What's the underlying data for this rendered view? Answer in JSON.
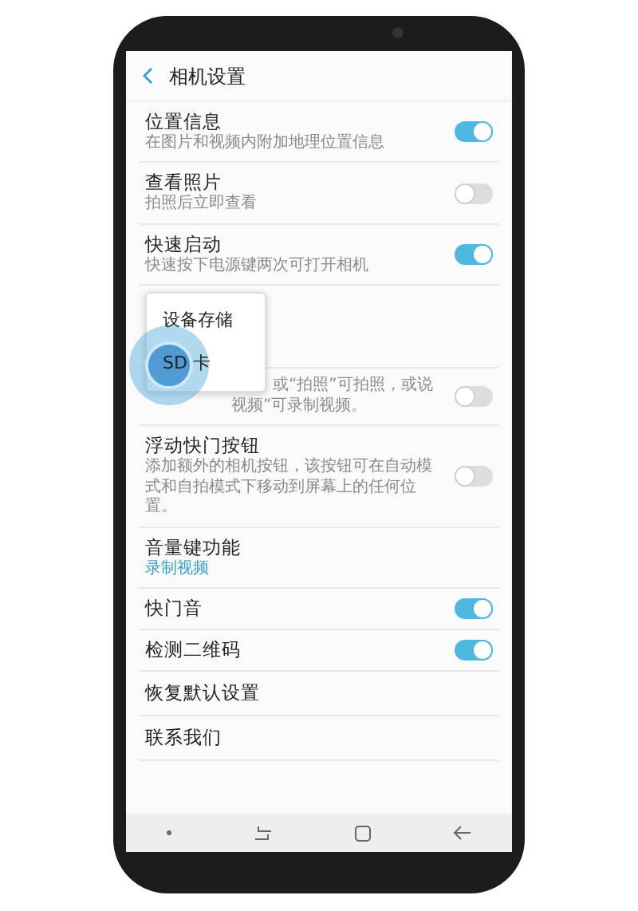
{
  "screen_title": "相机设置",
  "settings": [
    {
      "kind": "toggle",
      "title": "位置信息",
      "subtitle": "在图片和视频内附加地理位置信息",
      "on": true
    },
    {
      "kind": "toggle",
      "title": "查看照片",
      "subtitle": "拍照后立即查看",
      "on": false
    },
    {
      "kind": "toggle",
      "title": "快速启动",
      "subtitle": "快速按下电源键两次可打开相机",
      "on": true
    },
    {
      "kind": "covered"
    },
    {
      "kind": "toggle",
      "subtitle_lines": [
        "或“拍照”可拍照，或说",
        "视频”可录制视频。"
      ],
      "on": false
    },
    {
      "kind": "toggle",
      "title": "浮动快门按钮",
      "subtitle": "添加额外的相机按钮，该按钮可在自动模式和自拍模式下移动到屏幕上的任何位置。",
      "on": false
    },
    {
      "kind": "value",
      "title": "音量键功能",
      "value": "录制视频"
    },
    {
      "kind": "toggle",
      "title": "快门音",
      "on": true
    },
    {
      "kind": "toggle",
      "title": "检测二维码",
      "on": true
    },
    {
      "kind": "plain",
      "title": "恢复默认设置"
    },
    {
      "kind": "plain",
      "title": "联系我们"
    }
  ],
  "popup": {
    "options": [
      "设备存储",
      "SD 卡"
    ]
  }
}
